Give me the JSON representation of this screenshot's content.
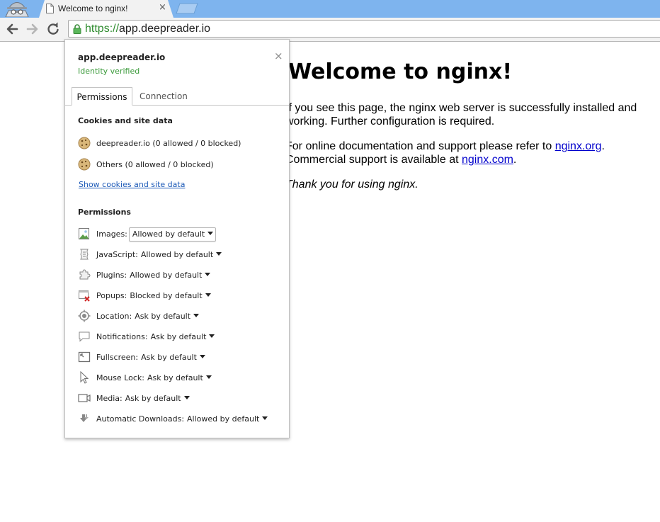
{
  "browser": {
    "tab_title": "Welcome to nginx!",
    "tab_close": "×",
    "url_scheme": "https://",
    "url_host": "app.deepreader.io"
  },
  "page": {
    "heading": "Welcome to nginx!",
    "p1": "If you see this page, the nginx web server is successfully installed and working. Further configuration is required.",
    "p2_before": "For online documentation and support please refer to ",
    "p2_link1": "nginx.org",
    "p2_mid": ".",
    "p2_line2_before": "Commercial support is available at ",
    "p2_link2": "nginx.com",
    "p2_end": ".",
    "p3": "Thank you for using nginx."
  },
  "bubble": {
    "site": "app.deepreader.io",
    "identity": "Identity verified",
    "close": "×",
    "tabs": [
      "Permissions",
      "Connection"
    ],
    "cookies_title": "Cookies and site data",
    "cookies": [
      {
        "label": "deepreader.io (0 allowed / 0 blocked)"
      },
      {
        "label": "Others (0 allowed / 0 blocked)"
      }
    ],
    "show_cookies_link": "Show cookies and site data",
    "permissions_title": "Permissions",
    "permissions": [
      {
        "name": "Images:",
        "value": "Allowed by default",
        "icon": "image-icon"
      },
      {
        "name": "JavaScript:",
        "value": "Allowed by default",
        "icon": "script-icon"
      },
      {
        "name": "Plugins:",
        "value": "Allowed by default",
        "icon": "puzzle-icon"
      },
      {
        "name": "Popups:",
        "value": "Blocked by default",
        "icon": "popup-blocked-icon"
      },
      {
        "name": "Location:",
        "value": "Ask by default",
        "icon": "location-icon"
      },
      {
        "name": "Notifications:",
        "value": "Ask by default",
        "icon": "speech-bubble-icon"
      },
      {
        "name": "Fullscreen:",
        "value": "Ask by default",
        "icon": "fullscreen-icon"
      },
      {
        "name": "Mouse Lock:",
        "value": "Ask by default",
        "icon": "cursor-icon"
      },
      {
        "name": "Media:",
        "value": "Ask by default",
        "icon": "camera-icon"
      },
      {
        "name": "Automatic Downloads:",
        "value": "Allowed by default",
        "icon": "download-icon"
      }
    ]
  }
}
